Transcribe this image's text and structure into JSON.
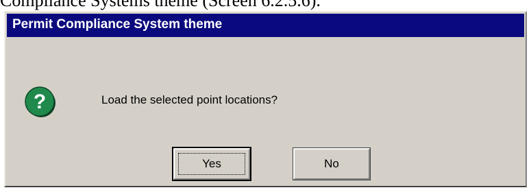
{
  "document": {
    "caption": "Compliance Systems theme (Screen 6.2.5.6)."
  },
  "dialog": {
    "title": "Permit Compliance System theme",
    "icon": "question-icon",
    "message": "Load the selected point locations?",
    "buttons": {
      "yes_label": "Yes",
      "no_label": "No"
    }
  },
  "colors": {
    "title_bar": "#0a0a7e",
    "dialog_bg": "#d4d0c8",
    "icon_green": "#1f8a4c"
  }
}
